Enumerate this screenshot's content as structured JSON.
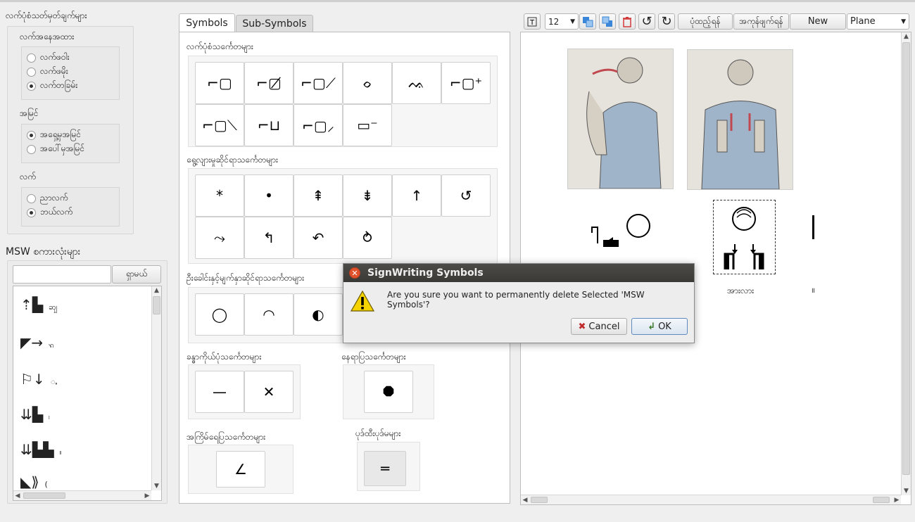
{
  "left": {
    "handshape_header": "လက်ပုံစံသတ်မှတ်ချက်များ",
    "state_label": "လက်အနေအထား",
    "state_options": [
      "လက်ဖဝါး",
      "လက်ဖမိုး",
      "လက်တခြမ်း"
    ],
    "state_selected": 2,
    "view_label": "အမြင်",
    "view_options": [
      "အရှေ့မှအမြင်",
      "အပေါ်မှအမြင်"
    ],
    "view_selected": 0,
    "hand_label": "လက်",
    "hand_options": [
      "ညာလက်",
      "ဘယ်လက်"
    ],
    "hand_selected": 1,
    "msw_header": "MSW စကားလုံးများ",
    "search_value": "",
    "search_button": "ရှာမယ်",
    "list_items": [
      {
        "glyph": "⇡▙",
        "suffix": "ꩿ"
      },
      {
        "glyph": "◤→",
        "suffix": "ꩫ"
      },
      {
        "glyph": "⚐↓",
        "suffix": "ꩻ"
      },
      {
        "glyph": "⇊▙",
        "suffix": "၊"
      },
      {
        "glyph": "⇊▙▙",
        "suffix": "။"
      },
      {
        "glyph": "◣⟫",
        "suffix": "("
      }
    ]
  },
  "tabs": [
    "Symbols",
    "Sub-Symbols"
  ],
  "active_tab": 0,
  "categories": {
    "hand": {
      "title": "လက်ပုံစံသင်္ကေတများ",
      "cells": [
        "⌐▢",
        "⌐▢̸",
        "⌐▢⟋",
        "ᨔ",
        "ᨕ",
        "⌐▢⁺",
        "⌐▢⟍",
        "⌐⊔",
        "⌐▢⸝",
        "▭⁻"
      ]
    },
    "movement": {
      "title": "ရွေ့လျားမှုဆိုင်ရာသင်္ကေတများ",
      "cells": [
        "*",
        "•",
        "⇞",
        "⇟",
        "↑",
        "↺",
        "⤳",
        "↰",
        "↶",
        "⥁"
      ]
    },
    "head": {
      "title": "ဦးခေါင်းနှင့်မျက်နှာဆိုင်ရာသင်္ကေတများ",
      "cells": [
        "◯",
        "◠",
        "◐"
      ]
    },
    "body": {
      "title": "ခန္ဓာကိုယ်ပုံသင်္ကေတများ",
      "cells": [
        "—",
        "✕"
      ]
    },
    "location": {
      "title": "နေရာပြသင်္ကေတများ",
      "cells": [
        "⯃"
      ]
    },
    "dynamics": {
      "title": "အကြိမ်ရေပြသင်္ကေတများ",
      "cells": [
        "∠"
      ]
    },
    "punctuation": {
      "title": "ပုဒ်ထီးပုဒ်မများ",
      "cells": [
        "═"
      ]
    }
  },
  "toolbar": {
    "font_size": "12",
    "sequence_button": "ပုံထည့်ရန်",
    "copy_button": "အကုန်ဖျက်ရန်",
    "new_button": "New",
    "plane_value": "Plane"
  },
  "canvas": {
    "sign_caption": "အားလား",
    "end_mark": "॥"
  },
  "dialog": {
    "title": "SignWriting Symbols",
    "message": "Are you sure you want to permanently delete Selected 'MSW Symbols'?",
    "cancel": "Cancel",
    "ok": "OK"
  }
}
